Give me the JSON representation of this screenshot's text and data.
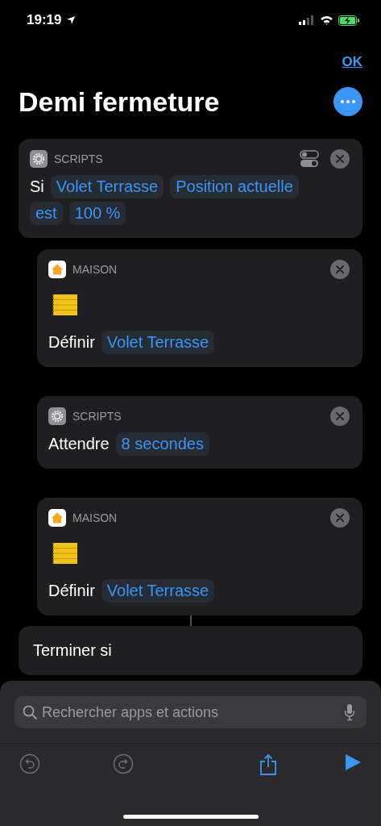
{
  "status_bar": {
    "time": "19:19"
  },
  "nav": {
    "done": "OK",
    "title": "Demi fermeture"
  },
  "actions": [
    {
      "kind": "if",
      "app_label": "SCRIPTS",
      "indented": false,
      "tokens": [
        {
          "kind": "word",
          "text": "Si"
        },
        {
          "kind": "param",
          "text": "Volet Terrasse"
        },
        {
          "kind": "param",
          "text": "Position actuelle"
        },
        {
          "kind": "param",
          "text": "est"
        },
        {
          "kind": "param",
          "text": "100 %"
        }
      ]
    },
    {
      "kind": "home",
      "app_label": "MAISON",
      "indented": true,
      "tokens": [
        {
          "kind": "word",
          "text": "Définir"
        },
        {
          "kind": "param",
          "text": "Volet Terrasse"
        }
      ]
    },
    {
      "kind": "wait",
      "app_label": "SCRIPTS",
      "indented": true,
      "tokens": [
        {
          "kind": "word",
          "text": "Attendre"
        },
        {
          "kind": "param",
          "text": "8 secondes"
        }
      ]
    },
    {
      "kind": "home",
      "app_label": "MAISON",
      "indented": true,
      "tokens": [
        {
          "kind": "word",
          "text": "Définir"
        },
        {
          "kind": "param",
          "text": "Volet Terrasse"
        }
      ]
    },
    {
      "kind": "end",
      "indented": false,
      "tokens": [
        {
          "kind": "word",
          "text": "Terminer si"
        }
      ]
    }
  ],
  "search": {
    "placeholder": "Rechercher apps et actions"
  },
  "toolbar": [
    {
      "kind": "undo",
      "disabled": true
    },
    {
      "kind": "redo",
      "disabled": true
    },
    {
      "kind": "share",
      "disabled": false
    },
    {
      "kind": "run",
      "disabled": false
    }
  ]
}
